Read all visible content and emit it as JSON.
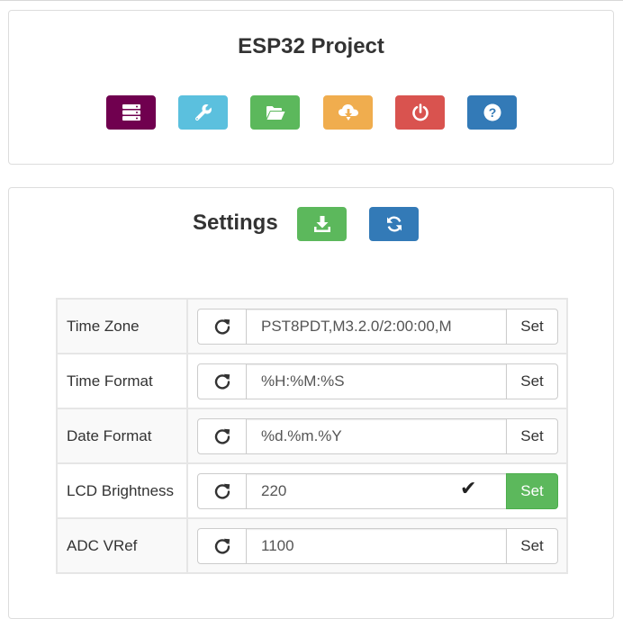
{
  "app": {
    "title": "ESP32 Project"
  },
  "toolbar": [
    {
      "name": "server-icon",
      "color": "#70004f"
    },
    {
      "name": "wrench-icon",
      "color": "#5bc0de"
    },
    {
      "name": "folder-open-icon",
      "color": "#5cb85c"
    },
    {
      "name": "cloud-download-icon",
      "color": "#f0ad4e"
    },
    {
      "name": "power-icon",
      "color": "#d9534f"
    },
    {
      "name": "question-icon",
      "color": "#337ab7"
    }
  ],
  "settings": {
    "title": "Settings",
    "save_icon": "download-icon",
    "save_color": "#5cb85c",
    "refresh_icon": "refresh-icon",
    "refresh_color": "#337ab7",
    "rows": [
      {
        "label": "Time Zone",
        "value": "PST8PDT,M3.2.0/2:00:00,M",
        "set_label": "Set",
        "status": "default"
      },
      {
        "label": "Time Format",
        "value": "%H:%M:%S",
        "set_label": "Set",
        "status": "default"
      },
      {
        "label": "Date Format",
        "value": "%d.%m.%Y",
        "set_label": "Set",
        "status": "default"
      },
      {
        "label": "LCD Brightness",
        "value": "220",
        "set_label": "Set",
        "status": "success",
        "status_icon": "check-icon",
        "status_color": "#5cb85c"
      },
      {
        "label": "ADC VRef",
        "value": "1100",
        "set_label": "Set",
        "status": "default"
      }
    ]
  }
}
